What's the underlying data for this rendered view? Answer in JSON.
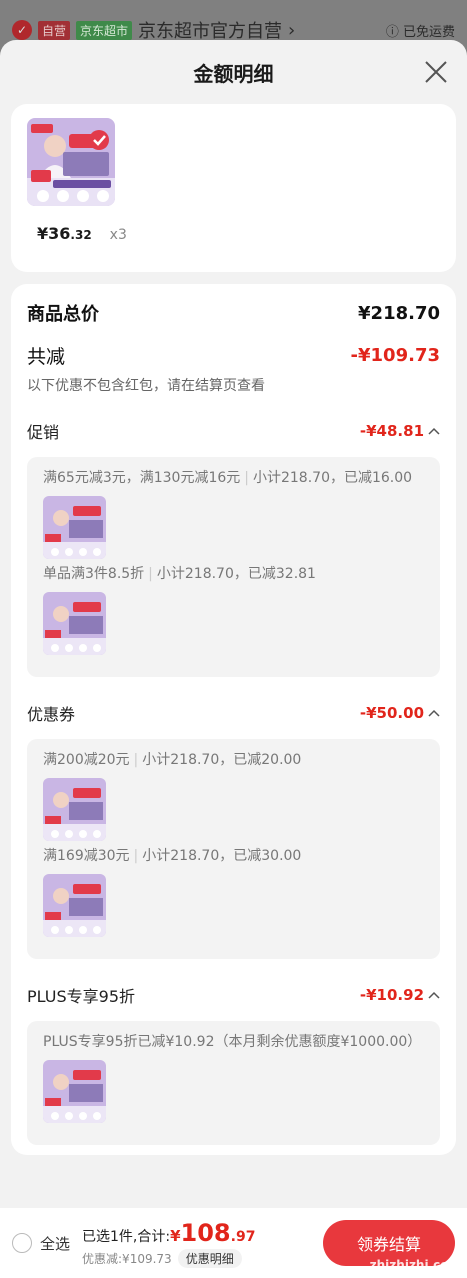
{
  "store": {
    "check": "✓",
    "self_tag": "自营",
    "jd_tag": "京东超市",
    "name": "京东超市官方自营",
    "chevron": "›",
    "shipping": "ⓘ 已免运费"
  },
  "sheet": {
    "title": "金额明细",
    "close_icon": "close-icon"
  },
  "product": {
    "thumb_badges": {
      "brand": "flyle",
      "promo": "5.5折",
      "banner": "店铺超大尺寸 爆款推荐"
    },
    "price_int": "¥36",
    "price_dec": ".32",
    "qty": "x3"
  },
  "summary": {
    "total_label": "商品总价",
    "total_value": "¥218.70",
    "reduce_label": "共减",
    "reduce_value": "-¥109.73",
    "note": "以下优惠不包含红包，请在结算页查看"
  },
  "sections": [
    {
      "label": "促销",
      "value": "-¥48.81",
      "items": [
        {
          "text": "满65元减3元，满130元减16元",
          "sub": "小计218.70，已减16.00"
        },
        {
          "text": "单品满3件8.5折",
          "sub": "小计218.70，已减32.81"
        }
      ]
    },
    {
      "label": "优惠券",
      "value": "-¥50.00",
      "items": [
        {
          "text": "满200减20元",
          "sub": "小计218.70，已减20.00"
        },
        {
          "text": "满169减30元",
          "sub": "小计218.70，已减30.00"
        }
      ]
    },
    {
      "label": "PLUS专享95折",
      "value": "-¥10.92",
      "items": [
        {
          "text": "PLUS专享95折已减¥10.92（本月剩余优惠额度¥1000.00）",
          "sub": ""
        }
      ]
    }
  ],
  "bottom": {
    "select_all": "全选",
    "selected": "已选1件,合计:",
    "total_cur": "¥",
    "total_int": "108",
    "total_dec": ".97",
    "discount": "优惠减:¥109.73",
    "detail_btn": "优惠明细",
    "checkout": "领券结算"
  },
  "watermark": "zhizhizhi.com",
  "colors": {
    "accent": "#e1251b",
    "checkout": "#e8383d"
  }
}
